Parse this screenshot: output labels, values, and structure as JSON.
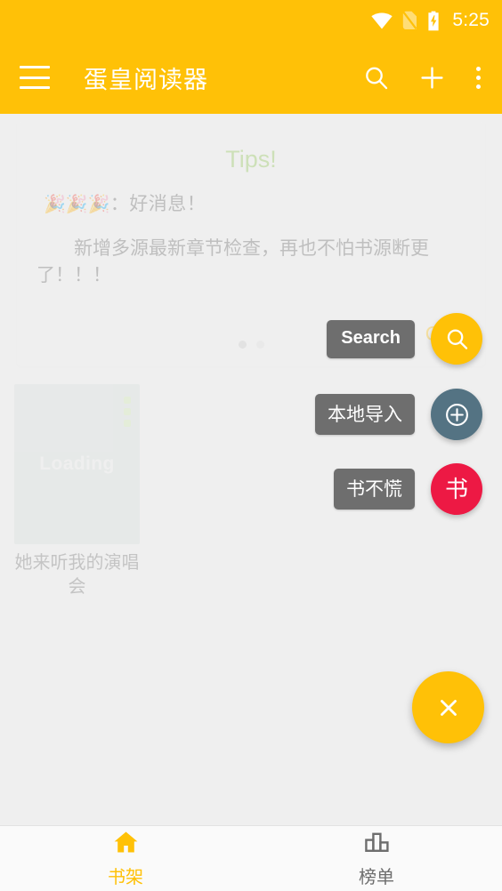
{
  "status_bar": {
    "time": "5:25",
    "icons": [
      "wifi-icon",
      "sim-card-off-icon",
      "battery-charging-icon"
    ]
  },
  "app_bar": {
    "title": "蛋皇阅读器",
    "menu_icon": "hamburger-menu-icon",
    "actions": [
      {
        "name": "search-icon",
        "label": "搜索"
      },
      {
        "name": "add-icon",
        "label": "添加"
      },
      {
        "name": "overflow-menu-icon",
        "label": "更多"
      }
    ],
    "background": "#FFC107"
  },
  "tips_card": {
    "title": "Tips!",
    "title_color": "#8BC34A",
    "emoji": "🎉🎉🎉",
    "line1": "：好消息！",
    "body": "新增多源最新章节检查，再也不怕书源断更了！！！",
    "ok_label": "OK",
    "ok_color": "#FFC107",
    "page_dots": 2,
    "active_dot": 1
  },
  "bookshelf": {
    "books": [
      {
        "title": "她来听我的演唱会",
        "cover_text": "Loading",
        "menu_icon": "book-overflow-icon"
      }
    ]
  },
  "fab_menu": {
    "expanded": true,
    "main": {
      "icon": "close-icon",
      "color": "#FFC107"
    },
    "items": [
      {
        "label": "Search",
        "icon": "search-icon",
        "color": "#FFC107"
      },
      {
        "label": "本地导入",
        "icon": "add-circle-icon",
        "color": "#547383"
      },
      {
        "label": "书不慌",
        "icon": "书",
        "color": "#ED1944"
      }
    ]
  },
  "bottom_nav": {
    "items": [
      {
        "label": "书架",
        "icon": "home-icon",
        "active": true,
        "color": "#FFC107"
      },
      {
        "label": "榜单",
        "icon": "bar-chart-icon",
        "active": false,
        "color": "#6E6E6E"
      }
    ]
  }
}
